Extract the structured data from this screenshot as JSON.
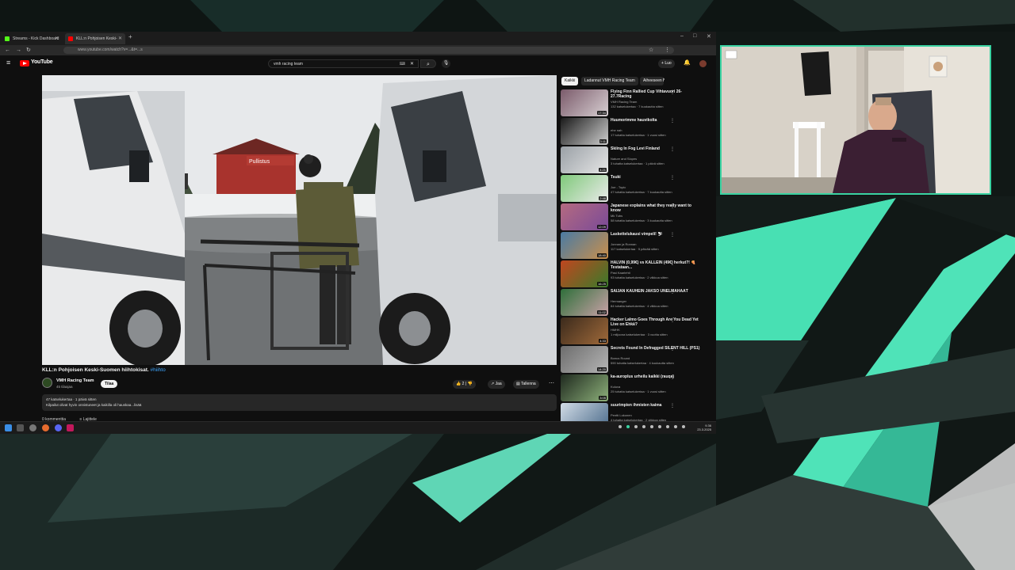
{
  "colors": {
    "accent_teal": "#3ad3a2",
    "youtube_red": "#ff0000",
    "hashtag_blue": "#3ea6ff",
    "page_bg": "#0f0f0f"
  },
  "browser": {
    "tabs": [
      {
        "label": "Streams - Kick Dashboard",
        "active": false
      },
      {
        "label": "KLL:n Pohjoisen Keski-Suomen...",
        "active": true
      }
    ],
    "url": "www.youtube.com/watch?v=...&t=...s"
  },
  "youtube": {
    "logo_text": "YouTube",
    "search_value": "vmh racing team",
    "create_label": "Luo"
  },
  "video": {
    "title": "KLL:n Pohjoisen Keski-Suomen hiihtokisat.",
    "hashtag": "#hiihto",
    "channel": "VMH Racing Team",
    "subscribers": "45 tilaajaa",
    "join_label": "Tilaa",
    "likes": "2",
    "share_label": "Jaa",
    "save_label": "Tallenna",
    "description_line1": "47 katselukertaa · 1 päivä sitten",
    "description_line2": "Kilpailut olivat hyvin onnistuneet ja kaikilla oli hauskaa...lisää",
    "comments_label": "0 kommenttia",
    "sort_label": "Lajittele",
    "sign_text": "Pullistus"
  },
  "chips": [
    "Kaikki",
    "Ladannut VMH Racing Team",
    "Aiheeseen liittyvät"
  ],
  "recommendations": [
    {
      "title": "Flying Finn Rallied Cup Vihtavuori 26-27.7Racing",
      "channel": "VMH Racing Team",
      "meta": "132 katselukertaa · 7 kuukautta sitten",
      "duration": "17:34",
      "c1": "#7b5b6b",
      "c2": "#d7cfd2"
    },
    {
      "title": "Huumorimme hauvikolta",
      "channel": "ehe nah",
      "meta": "17 tuhatta katselukertaa · 1 vuosi sitten",
      "duration": "3:11",
      "c1": "#1a1a1a",
      "c2": "#cfcfcf"
    },
    {
      "title": "Skiing In Fog Levi Finland",
      "channel": "Nature and Slopes",
      "meta": "3 tuhatta katselukertaa · 1 päivä sitten",
      "duration": "4:21",
      "c1": "#9aa0a6",
      "c2": "#e6e6e6"
    },
    {
      "title": "Tsuki",
      "channel": "Joe - Topic",
      "meta": "47 tuhatta katselukertaa · 7 kuukautta sitten",
      "duration": "2:48",
      "c1": "#7fc97a",
      "c2": "#eaeaea"
    },
    {
      "title": "Japanese explains what they really want to know",
      "channel": "Mk Tubs",
      "meta": "58 tuhatta katselukertaa · 3 kuukautta sitten",
      "duration": "12:09",
      "c1": "#b46a80",
      "c2": "#7a4a98"
    },
    {
      "title": "Laskettelukausi vimpeli! ⛷",
      "channel": "Jonnan ja Ronnan",
      "meta": "117 katselukertaa · 5 päivää sitten",
      "duration": "18:40",
      "c1": "#4a7ba3",
      "c2": "#c98f4c"
    },
    {
      "title": "HALVIN (0,99€) vs KALLEIN (49€) herkut?! 🍕 Testataan...",
      "channel": "Pasi Kaarlehti",
      "meta": "93 tuhatta katselukertaa · 2 viikkoa sitten",
      "duration": "16:25",
      "c1": "#c0461f",
      "c2": "#3a7a2a"
    },
    {
      "title": "SAIJAN KAUHEIN JAKSO UNELMAHÄÄT",
      "channel": "Hermanger",
      "meta": "84 tuhatta katselukertaa · 4 viikkoa sitten",
      "duration": "11:02",
      "c1": "#2f6f3a",
      "c2": "#c9a1a7"
    },
    {
      "title": "Hacker Lalmo Goes Through Are You Dead Yet Live on Ehkä?",
      "channel": "HMHK",
      "meta": "1 miljoona katselukertaa · 3 vuotta sitten",
      "duration": "4:33",
      "c1": "#3b2a1c",
      "c2": "#a06a3a"
    },
    {
      "title": "Secrets Found In Defragged SILENT HILL (PS1)",
      "channel": "Bonus Round",
      "meta": "590 tuhatta katselukertaa · 4 kuukautta sitten",
      "duration": "14:20",
      "c1": "#6d6d6d",
      "c2": "#b5b5b5"
    },
    {
      "title": "ka-auroplus urheilu kaikki (rauqa)",
      "channel": "Kuluva",
      "meta": "25 tuhatta katselukertaa · 1 vuosi sitten",
      "duration": "3:05",
      "c1": "#1f2a1f",
      "c2": "#8db07a"
    },
    {
      "title": "suurimpien ihmisten kaima",
      "channel": "Pentti Lokonen",
      "meta": "4 tuhatta katselukertaa · 2 viikkoa sitten",
      "duration": "5:12",
      "c1": "#d2dce6",
      "c2": "#4a6a8a"
    }
  ],
  "taskbar": {
    "time": "9.36",
    "date": "23.3.2025"
  }
}
